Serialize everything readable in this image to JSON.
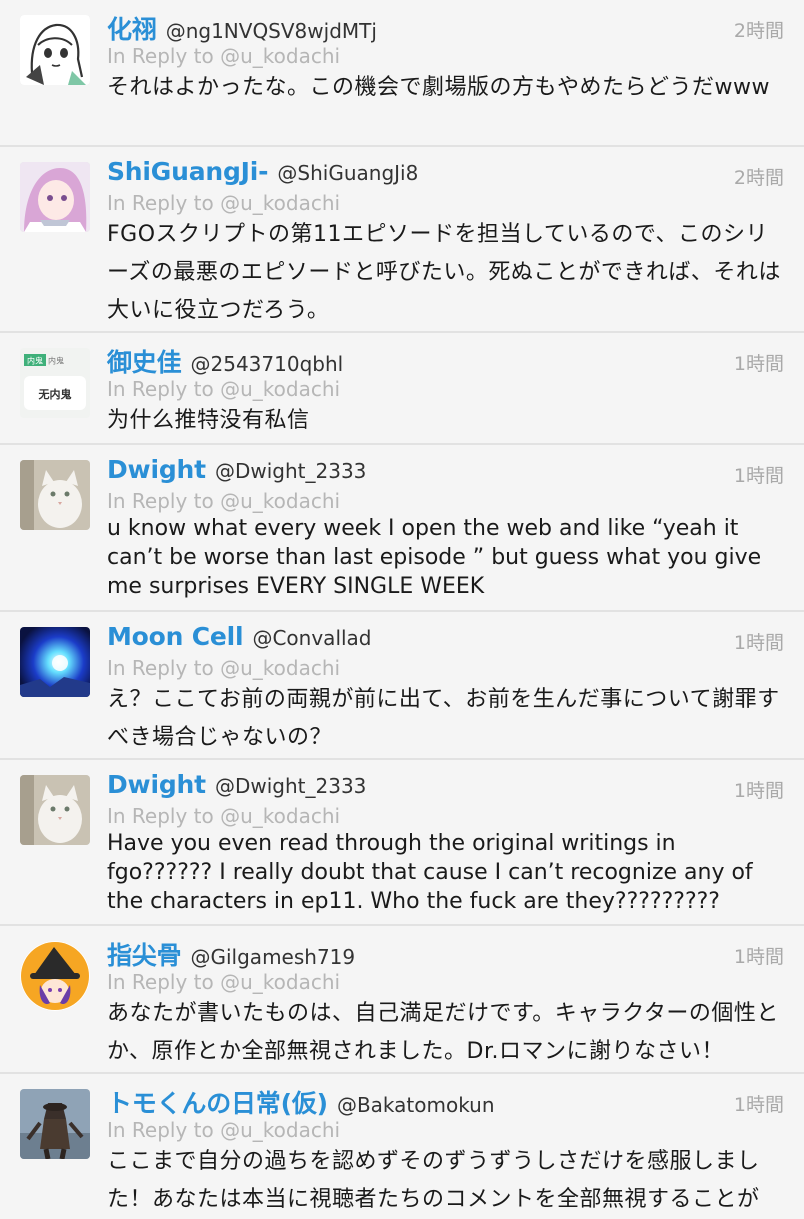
{
  "tweets": [
    {
      "display_name": "化祤",
      "screen_name": "@ng1NVQSV8wjdMTj",
      "time": "2時間",
      "reply_label": "In Reply to @u_kodachi",
      "text": "それはよかったな。この機会で劇場版の方もやめたらどうだwww",
      "avatar": "anime-girl-sketch"
    },
    {
      "display_name": "ShiGuangJi-",
      "screen_name": "@ShiGuangJi8",
      "time": "2時間",
      "reply_label": "In Reply to @u_kodachi",
      "text": "FGOスクリプトの第11エピソードを担当しているので、このシリーズの最悪のエピソードと呼びたい。死ぬことができれば、それは大いに役立つだろう。",
      "avatar": "pink-hair-anime"
    },
    {
      "display_name": "御史佳",
      "screen_name": "@2543710qbhl",
      "time": "1時間",
      "reply_label": "In Reply to @u_kodachi",
      "text": "为什么推特没有私信",
      "avatar": "text-badge",
      "avatar_texts": [
        "内鬼",
        "内鬼",
        "无内鬼"
      ]
    },
    {
      "display_name": "Dwight",
      "screen_name": "@Dwight_2333",
      "time": "1時間",
      "reply_label": "In Reply to @u_kodachi",
      "text": "u know what every week I open the web and like “yeah it can’t be worse than last episode ” but guess what you give me surprises EVERY SINGLE WEEK",
      "avatar": "white-cat"
    },
    {
      "display_name": "Moon Cell",
      "screen_name": "@Convallad",
      "time": "1時間",
      "reply_label": "In Reply to @u_kodachi",
      "text": "え？ここてお前の両親が前に出て、お前を生んだ事について謝罪すべき場合じゃないの？",
      "avatar": "blue-glow"
    },
    {
      "display_name": "Dwight",
      "screen_name": "@Dwight_2333",
      "time": "1時間",
      "reply_label": "In Reply to @u_kodachi",
      "text": "Have you even read through the original writings in fgo?????? I really doubt that cause I can’t recognize any of the characters in ep11. Who the fuck are they?????????",
      "avatar": "white-cat"
    },
    {
      "display_name": "指尖骨",
      "screen_name": "@Gilgamesh719",
      "time": "1時間",
      "reply_label": "In Reply to @u_kodachi",
      "text": "あなたが書いたものは、自己満足だけです。キャラクターの個性とか、原作とか全部無視されました。Dr.ロマンに謝りなさい！",
      "avatar": "witch-hat"
    },
    {
      "display_name": "トモくんの日常(仮)",
      "screen_name": "@Bakatomokun",
      "time": "1時間",
      "reply_label": "In Reply to @u_kodachi",
      "text": "ここまで自分の過ちを認めずそのずうずうしさだけを感服しました！あなたは本当に視聴者たちのコメントを全部無視することが",
      "avatar": "hunter-figure"
    }
  ]
}
